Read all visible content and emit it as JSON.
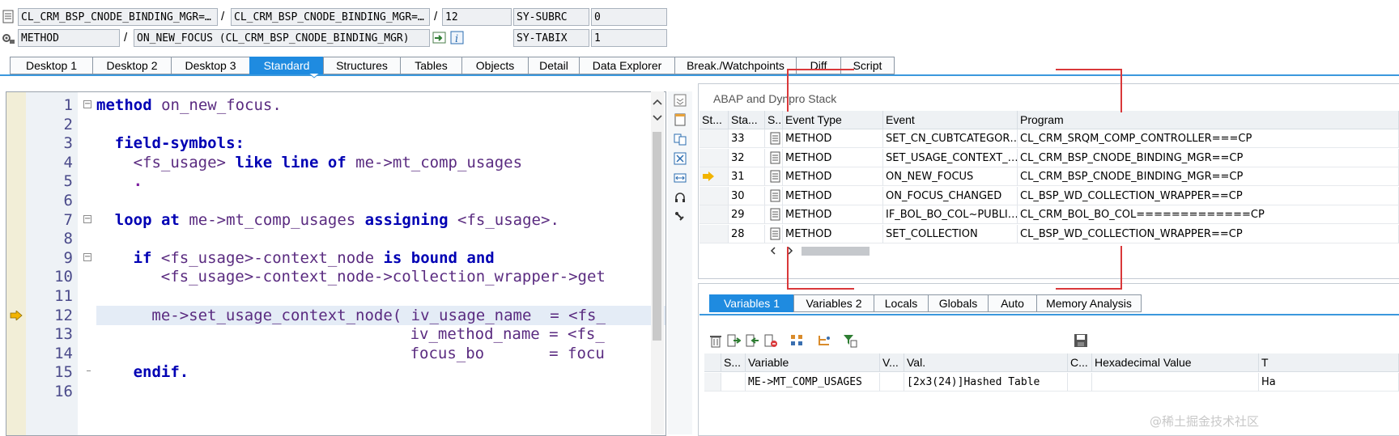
{
  "header": {
    "row1": {
      "class_field": "CL_CRM_BSP_CNODE_BINDING_MGR=…",
      "include_field": "CL_CRM_BSP_CNODE_BINDING_MGR=…",
      "separator": "/",
      "line_field": "12",
      "sy_label": "SY-SUBRC",
      "sy_value": "0"
    },
    "row2": {
      "type_field": "METHOD",
      "separator": "/",
      "method_field": "ON_NEW_FOCUS (CL_CRM_BSP_CNODE_BINDING_MGR)",
      "sy_label": "SY-TABIX",
      "sy_value": "1"
    }
  },
  "tabs": [
    "Desktop 1",
    "Desktop 2",
    "Desktop 3",
    "Standard",
    "Structures",
    "Tables",
    "Objects",
    "Detail",
    "Data Explorer",
    "Break./Watchpoints",
    "Diff",
    "Script"
  ],
  "active_tab": "Standard",
  "code": {
    "lines": [
      {
        "n": "1"
      },
      {
        "n": "2"
      },
      {
        "n": "3"
      },
      {
        "n": "4"
      },
      {
        "n": "5"
      },
      {
        "n": "6"
      },
      {
        "n": "7"
      },
      {
        "n": "8"
      },
      {
        "n": "9"
      },
      {
        "n": "10"
      },
      {
        "n": "11"
      },
      {
        "n": "12"
      },
      {
        "n": "13"
      },
      {
        "n": "14"
      },
      {
        "n": "15"
      },
      {
        "n": "16"
      }
    ],
    "l1": {
      "kw": "method",
      "rest": " on_new_focus."
    },
    "l3": {
      "kw": "field-symbols:"
    },
    "l4": {
      "a": "<fs_usage> ",
      "kw": "like line of",
      "b": " me->mt_comp_usages"
    },
    "l5": {
      "a": "."
    },
    "l7": {
      "kw1": "loop at",
      "a": " me->mt_comp_usages ",
      "kw2": "assigning",
      "b": " <fs_usage>."
    },
    "l9": {
      "kw1": "if",
      "a": " <fs_usage>-context_node ",
      "kw2": "is bound and"
    },
    "l10": {
      "a": "<fs_usage>-context_node->collection_wrapper->get"
    },
    "l12": {
      "a": "me->set_usage_context_node( iv_usage_name  = <fs_"
    },
    "l13": {
      "a": "iv_method_name = <fs_"
    },
    "l14": {
      "a": "focus_bo       = focu"
    },
    "l15": {
      "kw": "endif."
    }
  },
  "stack": {
    "title": "ABAP and Dynpro Stack",
    "columns": [
      "St...",
      "Sta...",
      "S...",
      "Event Type",
      "Event",
      "Program"
    ],
    "rows": [
      {
        "level": "33",
        "type": "METHOD",
        "event": "SET_CN_CUBTCATEGOR…",
        "program": "CL_CRM_SRQM_COMP_CONTROLLER===CP"
      },
      {
        "level": "32",
        "type": "METHOD",
        "event": "SET_USAGE_CONTEXT_…",
        "program": "CL_CRM_BSP_CNODE_BINDING_MGR==CP"
      },
      {
        "level": "31",
        "type": "METHOD",
        "event": "ON_NEW_FOCUS",
        "program": "CL_CRM_BSP_CNODE_BINDING_MGR==CP"
      },
      {
        "level": "30",
        "type": "METHOD",
        "event": "ON_FOCUS_CHANGED",
        "program": "CL_BSP_WD_COLLECTION_WRAPPER==CP"
      },
      {
        "level": "29",
        "type": "METHOD",
        "event": "IF_BOL_BO_COL~PUBLI…",
        "program": "CL_CRM_BOL_BO_COL=============CP"
      },
      {
        "level": "28",
        "type": "METHOD",
        "event": "SET_COLLECTION",
        "program": "CL_BSP_WD_COLLECTION_WRAPPER==CP"
      }
    ],
    "current_row": "31"
  },
  "var_tabs": [
    "Variables 1",
    "Variables 2",
    "Locals",
    "Globals",
    "Auto",
    "Memory Analysis"
  ],
  "active_var_tab": "Variables 1",
  "variables": {
    "columns": [
      "S...",
      "Variable",
      "V...",
      "Val.",
      "C...",
      "Hexadecimal Value",
      "T"
    ],
    "rows": [
      {
        "variable": "ME->MT_COMP_USAGES",
        "value": "[2x3(24)]Hashed Table",
        "hex": "Ha"
      }
    ]
  },
  "watermark": "@稀土掘金技术社区",
  "colors": {
    "accent": "#1f8be0",
    "annotation": "#d9383a",
    "keyword": "#0000b4"
  }
}
